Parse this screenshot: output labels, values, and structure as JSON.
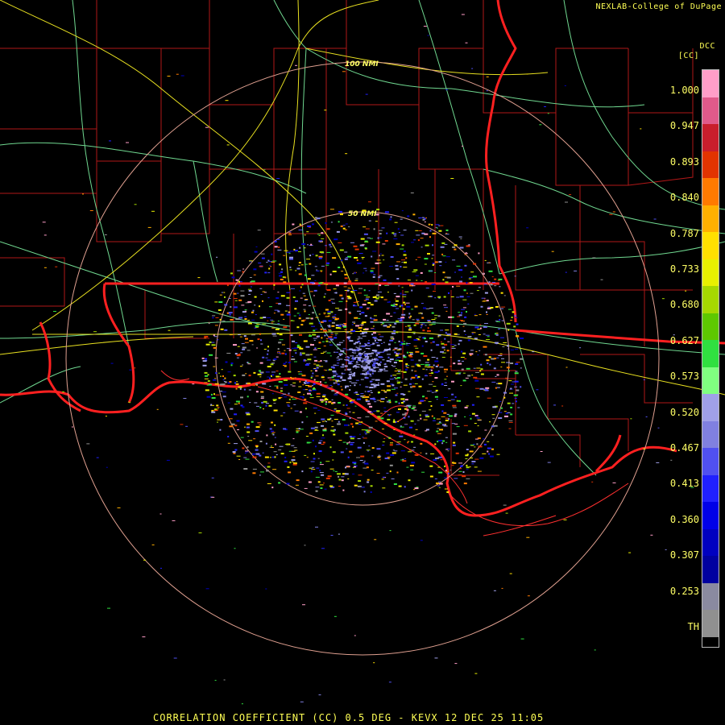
{
  "credit": "NEXLAB-College of DuPage",
  "brand": "DCC",
  "unit_label": "[CC]",
  "footer": "CORRELATION COEFFICIENT (CC) 0.5 DEG - KEVX 12 DEC 25 11:05",
  "rings": [
    {
      "label": "50 NMI",
      "radius_nmi": 50
    },
    {
      "label": "100 NMI",
      "radius_nmi": 100
    }
  ],
  "scale": {
    "ticks": [
      "1.000",
      "0.947",
      "0.893",
      "0.840",
      "0.787",
      "0.733",
      "0.680",
      "0.627",
      "0.573",
      "0.520",
      "0.467",
      "0.413",
      "0.360",
      "0.307",
      "0.253",
      "TH"
    ],
    "colors": [
      "#ff9ec8",
      "#e05a8a",
      "#c81e2c",
      "#e23400",
      "#ff7a00",
      "#ffb000",
      "#ffe000",
      "#e8f000",
      "#a6d800",
      "#5ec800",
      "#30e040",
      "#80ff80",
      "#a0a0e8",
      "#8080e0",
      "#5050f0",
      "#2020ff",
      "#0000e8",
      "#0000c0",
      "#0000a0",
      "#8a8aa0",
      "#909090"
    ]
  },
  "colors": {
    "state_border": "#ff2020",
    "county": "#b01818",
    "highway": "#e8e020",
    "road": "#70d890",
    "ring": "#e0a090"
  }
}
